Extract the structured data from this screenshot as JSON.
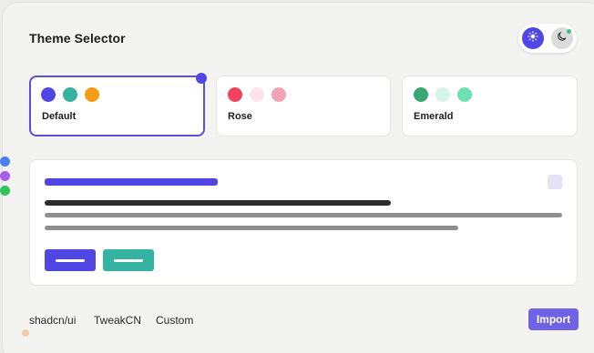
{
  "header": {
    "title": "Theme Selector"
  },
  "mode_toggle": {
    "light_icon": "sun-icon",
    "dark_icon": "moon-icon",
    "active": "light",
    "accent": "#5046e4",
    "status_color": "#3cc27f"
  },
  "themes": [
    {
      "name": "Default",
      "selected": true,
      "colors": [
        "#5046e4",
        "#34b3a3",
        "#f39c12"
      ]
    },
    {
      "name": "Rose",
      "selected": false,
      "colors": [
        "#f0435f",
        "#fde4e8",
        "#f4a3b0"
      ]
    },
    {
      "name": "Emerald",
      "selected": false,
      "colors": [
        "#3aa876",
        "#d3f6e7",
        "#6fe0b4"
      ]
    }
  ],
  "preview": {
    "primary_color": "#5046e4",
    "secondary_color": "#34b3a3"
  },
  "side_dots": [
    "#4b80f0",
    "#a65df0",
    "#34c05d"
  ],
  "footer": {
    "links": [
      "shadcn/ui",
      "TweakCN",
      "Custom"
    ],
    "import_label": "Import"
  }
}
